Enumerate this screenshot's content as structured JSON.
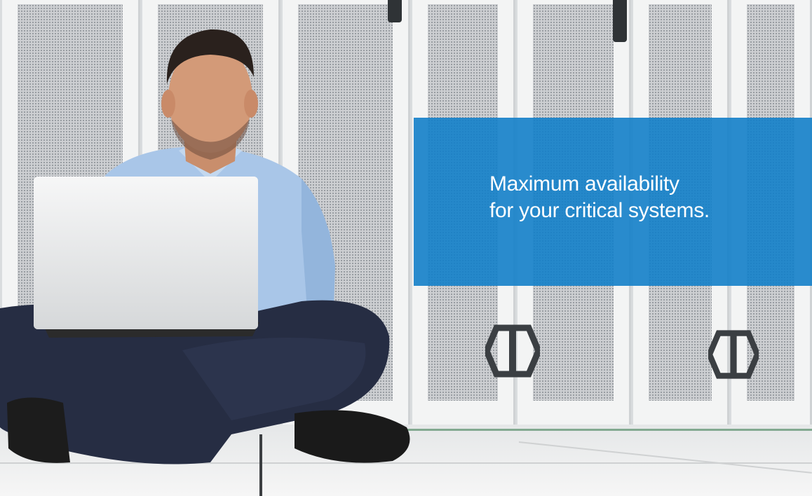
{
  "banner": {
    "line1": "Maximum availability",
    "line2": "for your critical systems.",
    "background_color": "#137fc9",
    "text_color": "#ffffff"
  },
  "photo": {
    "icon": "datacenter-photo"
  }
}
